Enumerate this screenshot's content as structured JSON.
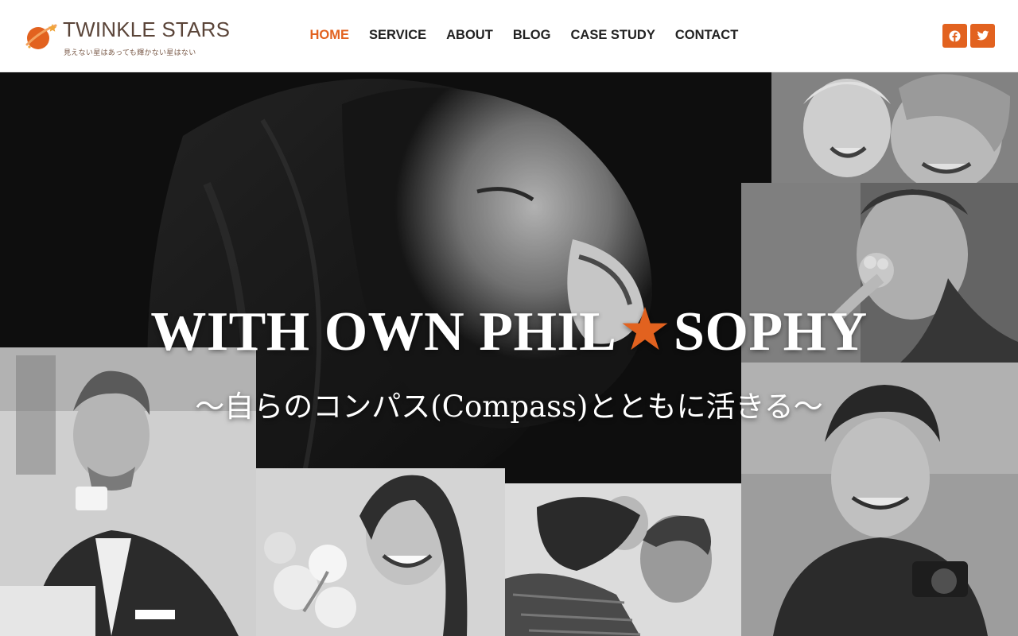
{
  "brand": {
    "name": "TWINKLE STARS",
    "tagline": "見えない星はあっても輝かない星はない",
    "accent_color": "#e2621f",
    "text_color": "#5a4438"
  },
  "nav": {
    "items": [
      {
        "label": "HOME",
        "active": true
      },
      {
        "label": "SERVICE",
        "active": false
      },
      {
        "label": "ABOUT",
        "active": false
      },
      {
        "label": "BLOG",
        "active": false
      },
      {
        "label": "CASE STUDY",
        "active": false
      },
      {
        "label": "CONTACT",
        "active": false
      }
    ]
  },
  "social": [
    {
      "icon": "facebook-icon"
    },
    {
      "icon": "twitter-icon"
    }
  ],
  "hero": {
    "title_before": "WITH OWN PHIL",
    "title_star": "★",
    "title_after": "SOPHY",
    "subtitle": "〜自らのコンパス(Compass)とともに活きる〜"
  }
}
